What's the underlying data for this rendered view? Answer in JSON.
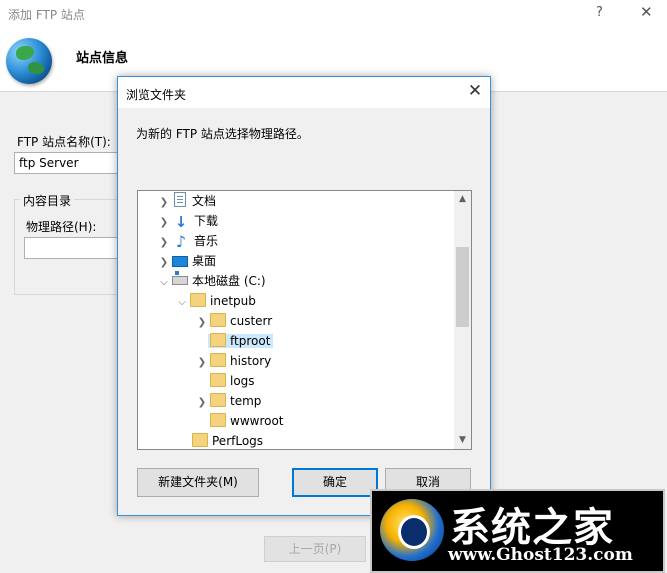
{
  "wizard": {
    "title": "添加 FTP 站点",
    "help": "?",
    "close": "✕",
    "heading": "站点信息",
    "site_name_label": "FTP 站点名称(T):",
    "site_name_value": "ftp Server",
    "content_group_label": "内容目录",
    "physical_path_label": "物理路径(H):",
    "physical_path_value": "",
    "prev_button": "上一页(P)"
  },
  "dialog": {
    "title": "浏览文件夹",
    "close": "✕",
    "description": "为新的 FTP 站点选择物理路径。",
    "tree": [
      {
        "label": "文档",
        "icon": "document-icon",
        "expanded": false
      },
      {
        "label": "下载",
        "icon": "download-icon",
        "expanded": false
      },
      {
        "label": "音乐",
        "icon": "music-icon",
        "expanded": false
      },
      {
        "label": "桌面",
        "icon": "desktop-icon",
        "expanded": false
      },
      {
        "label": "本地磁盘 (C:)",
        "icon": "drive-icon",
        "expanded": true
      },
      {
        "label": "inetpub",
        "icon": "folder-icon",
        "expanded": true
      },
      {
        "label": "custerr",
        "icon": "folder-icon",
        "expanded": false
      },
      {
        "label": "ftproot",
        "icon": "folder-icon",
        "selected": true
      },
      {
        "label": "history",
        "icon": "folder-icon",
        "expanded": false
      },
      {
        "label": "logs",
        "icon": "folder-icon"
      },
      {
        "label": "temp",
        "icon": "folder-icon",
        "expanded": false
      },
      {
        "label": "wwwroot",
        "icon": "folder-icon"
      },
      {
        "label": "PerfLogs",
        "icon": "folder-icon"
      }
    ],
    "new_folder_button": "新建文件夹(M)",
    "ok_button": "确定",
    "cancel_button": "取消"
  },
  "watermark": {
    "title": "系统之家",
    "url": "www.Ghost123.com"
  },
  "colors": {
    "accent": "#0078d7",
    "selection": "#cce8ff",
    "folder": "#f5d37c"
  }
}
